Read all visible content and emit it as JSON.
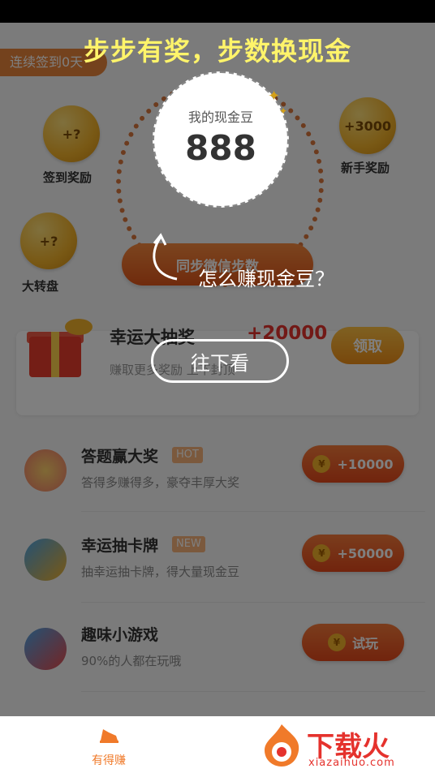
{
  "colors": {
    "accent": "#e5322d",
    "orange": "#f07a2a",
    "gold": "#f2b22a",
    "headline": "#fff46a"
  },
  "header": {
    "checkin_label": "连续签到0天"
  },
  "bubbles": [
    {
      "value": "+?",
      "label": "签到奖励",
      "icon": "coin-icon"
    },
    {
      "value": "+3000",
      "label": "新手奖励",
      "icon": "coin-icon"
    },
    {
      "value": "+?",
      "label": "大转盘",
      "icon": "coin-icon"
    }
  ],
  "balance": {
    "title": "我的现金豆",
    "value": "888"
  },
  "sync_button_label": "同步微信步数",
  "lottery": {
    "title": "幸运大抽奖",
    "amount": "+20000",
    "desc": "赚取更多奖励 上不封顶",
    "claim_label": "领取"
  },
  "tasks": [
    {
      "title": "答题赢大奖",
      "tag": "HOT",
      "desc": "答得多赚得多，豪夺丰厚大奖",
      "button": "+10000",
      "coin": "¥"
    },
    {
      "title": "幸运抽卡牌",
      "tag": "NEW",
      "desc": "抽幸运抽卡牌，得大量现金豆",
      "button": "+50000",
      "coin": "¥"
    },
    {
      "title": "趣味小游戏",
      "tag": "",
      "desc": "90%的人都在玩哦",
      "button": "试玩",
      "coin": "¥"
    }
  ],
  "overlay": {
    "headline": "步步有奖，步数换现金",
    "question": "怎么赚现金豆？",
    "scroll_hint": "往下看"
  },
  "bottom_nav": {
    "home_label": "有得赚",
    "home_icon": "running-shoe-icon"
  },
  "brand": {
    "name": "下载火",
    "url": "xiazaihuo.com"
  }
}
